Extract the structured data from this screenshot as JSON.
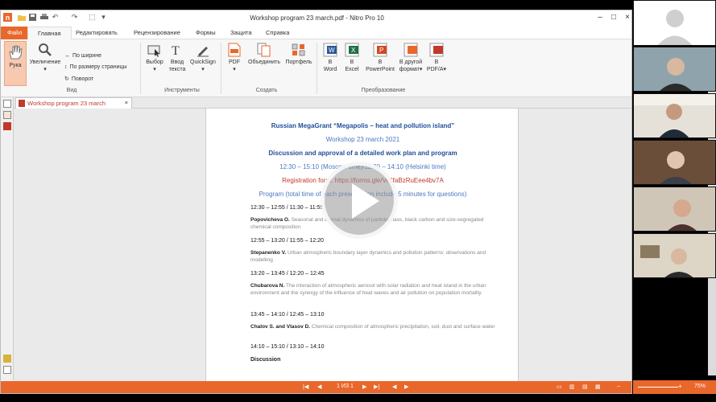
{
  "window": {
    "title": "Workshop program 23 march.pdf - Nitro Pro 10"
  },
  "tabs": [
    "Файл",
    "Главная",
    "Редактировать",
    "Рецензирование",
    "Формы",
    "Защита",
    "Справка"
  ],
  "ribbon": {
    "hand": "Рука",
    "zoom": "Увеличение",
    "fit_width": "По ширине",
    "fit_page": "По размеру страницы",
    "rotate": "Поворот",
    "group_view": "Вид",
    "select": "Выбор",
    "type_text_1": "Ввод",
    "type_text_2": "текста",
    "quicksign": "QuickSign",
    "group_tools": "Инструменты",
    "pdf": "PDF",
    "combine": "Объединить",
    "portfolio": "Портфель",
    "group_create": "Создать",
    "to_word_1": "В",
    "to_word_2": "Word",
    "to_excel_1": "В",
    "to_excel_2": "Excel",
    "to_ppt_1": "В",
    "to_ppt_2": "PowerPoint",
    "to_other_1": "В другой",
    "to_other_2": "формат",
    "to_pdfa_1": "В",
    "to_pdfa_2": "PDF/A",
    "group_convert": "Преобразование"
  },
  "doc_tab": "Workshop program 23 march",
  "document": {
    "title": "Russian MegaGrant “Megapolis – heat and pollution island”",
    "workshop": "Workshop 23 march 2021",
    "discussion": "Discussion and approval of a detailed work plan and program",
    "times": "12:30 – 15:10 (Moscow time)/11:30 – 14:10 (Helsinki time)",
    "registration": "Registration form: https://forms.gle/VrSfaBzRuEee4bv7A",
    "program": "Program (total time of each presentation include 5 minutes for questions)",
    "items": [
      {
        "time": "12:30 – 12:55 / 11:30 – 11:55",
        "speaker": "Popovicheva O.",
        "talk": "Seasonal and diurnal dynamics of particle mass, black carbon and size-segregated chemical composition"
      },
      {
        "time": "12:55 – 13:20 / 11:55 – 12:20",
        "speaker": "Stepanenko V.",
        "talk": "Urban atmospheric boundary layer dynamics and pollution patterns: observations and modelling"
      },
      {
        "time": "13:20 – 13:45 / 12:20 – 12:45",
        "speaker": "Chubarova N.",
        "talk": "The interaction of atmospheric aerosol with solar radiation and heat island in the urban environment and the synergy of the influence of heat waves and air pollution on population mortality."
      },
      {
        "time": "13:45 – 14:10 / 12:45 – 13:10",
        "speaker": "Chalov S. and Vlasov D.",
        "talk": "Chemical composition of atmospheric precipitation, soil, dust and surface water"
      },
      {
        "time": "14:10 – 15:10 / 13:10 – 14:10",
        "speaker": "Discussion",
        "talk": ""
      }
    ]
  },
  "status": {
    "page": "1 ИЗ 1",
    "zoom": "75%"
  },
  "colors": {
    "accent": "#e9672b",
    "doc_title": "#1f4e99",
    "doc_blue": "#4a78c2",
    "doc_red": "#c0392b"
  }
}
